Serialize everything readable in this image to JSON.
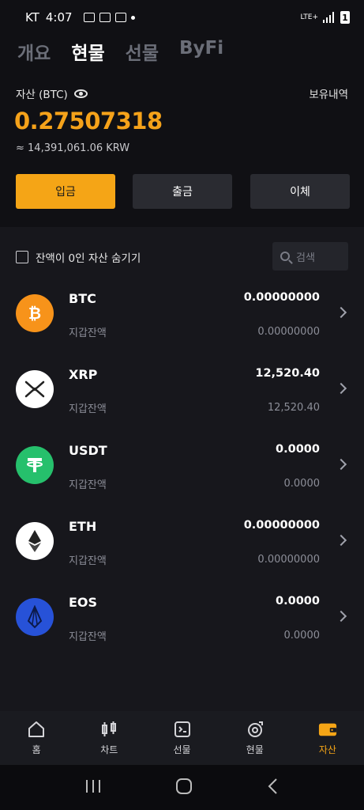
{
  "status_bar": {
    "carrier": "KT",
    "time": "4:07",
    "network": "LTE+",
    "battery": "1"
  },
  "tabs": [
    {
      "label": "개요",
      "active": false
    },
    {
      "label": "현물",
      "active": true
    },
    {
      "label": "선물",
      "active": false
    },
    {
      "label": "ByFi",
      "active": false
    }
  ],
  "asset": {
    "label": "자산 (BTC)",
    "holdings_label": "보유내역",
    "balance": "0.27507318",
    "krw_value": "≈  14,391,061.06 KRW"
  },
  "actions": {
    "deposit": "입금",
    "withdraw": "출금",
    "transfer": "이체"
  },
  "filter": {
    "hide_zero_label": "잔액이 0인 자산 숨기기",
    "search_placeholder": "검색"
  },
  "coins": [
    {
      "symbol": "BTC",
      "sub": "지갑잔액",
      "amount": "0.00000000",
      "available": "0.00000000",
      "icon": "bitcoin-icon",
      "color": "#f7931a"
    },
    {
      "symbol": "XRP",
      "sub": "지갑잔액",
      "amount": "12,520.40",
      "available": "12,520.40",
      "icon": "xrp-icon",
      "color": "#ffffff"
    },
    {
      "symbol": "USDT",
      "sub": "지갑잔액",
      "amount": "0.0000",
      "available": "0.0000",
      "icon": "tether-icon",
      "color": "#26c06c"
    },
    {
      "symbol": "ETH",
      "sub": "지갑잔액",
      "amount": "0.00000000",
      "available": "0.00000000",
      "icon": "ethereum-icon",
      "color": "#ffffff"
    },
    {
      "symbol": "EOS",
      "sub": "지갑잔액",
      "amount": "0.0000",
      "available": "0.0000",
      "icon": "eos-icon",
      "color": "#2752d8"
    }
  ],
  "bottom_nav": [
    {
      "label": "홈",
      "icon": "home-icon",
      "active": false
    },
    {
      "label": "차트",
      "icon": "chart-icon",
      "active": false
    },
    {
      "label": "선물",
      "icon": "futures-icon",
      "active": false
    },
    {
      "label": "현물",
      "icon": "spot-icon",
      "active": false
    },
    {
      "label": "자산",
      "icon": "wallet-icon",
      "active": true
    }
  ],
  "colors": {
    "accent": "#f5a516",
    "background": "#101014"
  }
}
